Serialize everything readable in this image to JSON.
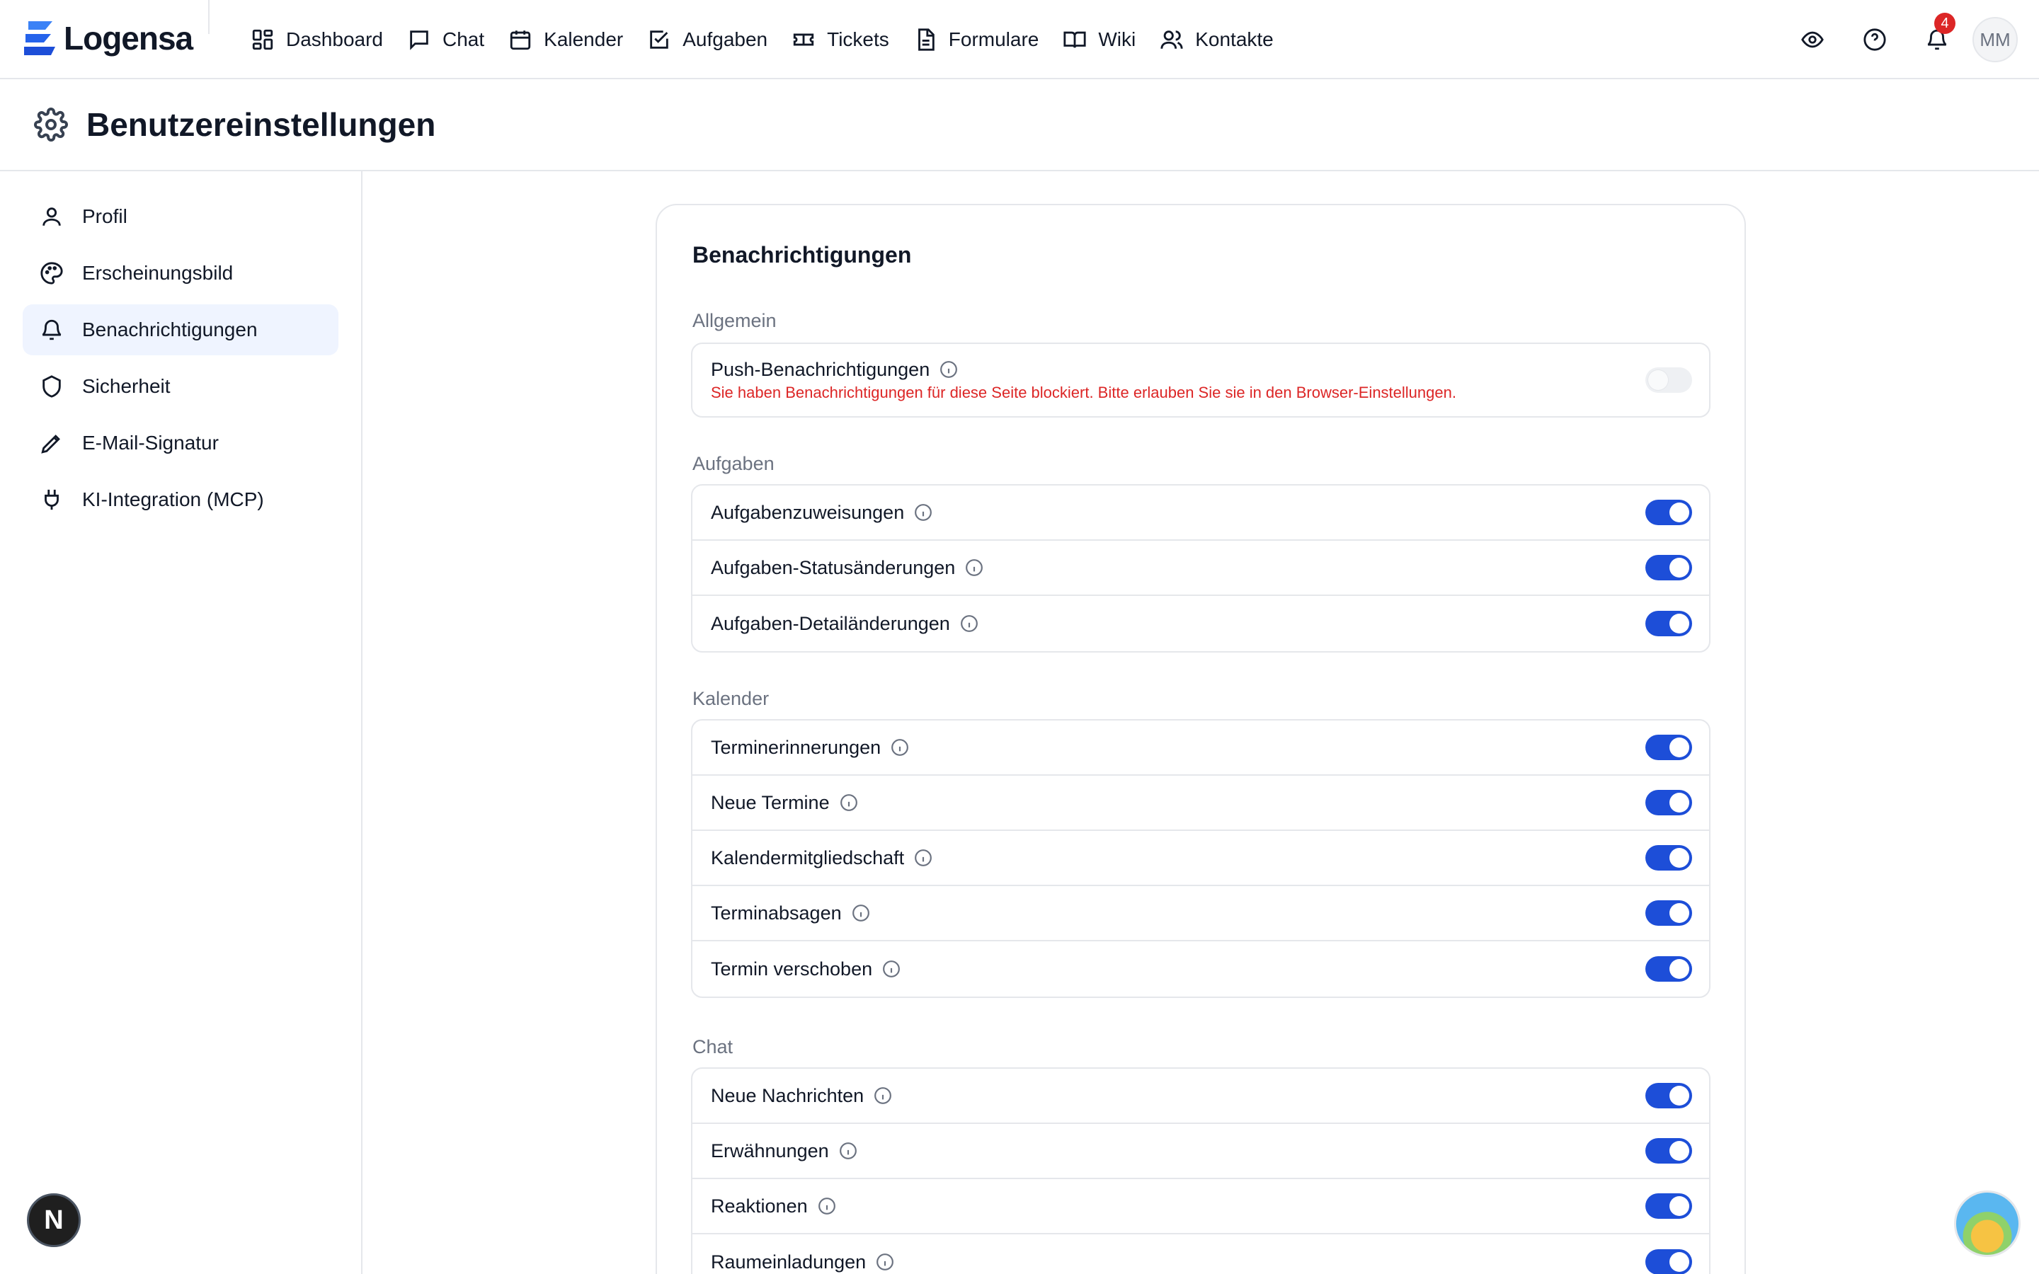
{
  "brand": {
    "name": "Logensa",
    "primary": "#1d4ed8",
    "accent": "#3b82f6"
  },
  "nav": [
    {
      "label": "Dashboard",
      "icon": "dashboard-icon"
    },
    {
      "label": "Chat",
      "icon": "chat-icon"
    },
    {
      "label": "Kalender",
      "icon": "calendar-icon"
    },
    {
      "label": "Aufgaben",
      "icon": "task-checkbox-icon"
    },
    {
      "label": "Tickets",
      "icon": "ticket-icon"
    },
    {
      "label": "Formulare",
      "icon": "form-document-icon"
    },
    {
      "label": "Wiki",
      "icon": "book-icon"
    },
    {
      "label": "Kontakte",
      "icon": "contacts-icon"
    }
  ],
  "topbar": {
    "notification_count": "4",
    "avatar_initials": "MM"
  },
  "page": {
    "title": "Benutzereinstellungen"
  },
  "sidebar": {
    "items": [
      {
        "label": "Profil",
        "icon": "user-icon"
      },
      {
        "label": "Erscheinungsbild",
        "icon": "palette-icon"
      },
      {
        "label": "Benachrichtigungen",
        "icon": "bell-icon",
        "active": true
      },
      {
        "label": "Sicherheit",
        "icon": "shield-icon"
      },
      {
        "label": "E-Mail-Signatur",
        "icon": "pen-icon"
      },
      {
        "label": "KI-Integration (MCP)",
        "icon": "plug-icon"
      }
    ]
  },
  "settings": {
    "title": "Benachrichtigungen",
    "general": {
      "label": "Allgemein",
      "push_label": "Push-Benachrichtigungen",
      "push_hint": "Sie haben Benachrichtigungen für diese Seite blockiert. Bitte erlauben Sie sie in den Browser-Einstellungen.",
      "push_enabled": false
    },
    "tasks": {
      "label": "Aufgaben",
      "items": [
        {
          "label": "Aufgabenzuweisungen",
          "enabled": true
        },
        {
          "label": "Aufgaben-Statusänderungen",
          "enabled": true
        },
        {
          "label": "Aufgaben-Detailänderungen",
          "enabled": true
        }
      ]
    },
    "calendar": {
      "label": "Kalender",
      "items": [
        {
          "label": "Terminerinnerungen",
          "enabled": true
        },
        {
          "label": "Neue Termine",
          "enabled": true
        },
        {
          "label": "Kalendermitgliedschaft",
          "enabled": true
        },
        {
          "label": "Terminabsagen",
          "enabled": true
        },
        {
          "label": "Termin verschoben",
          "enabled": true
        }
      ]
    },
    "chat": {
      "label": "Chat",
      "items": [
        {
          "label": "Neue Nachrichten",
          "enabled": true
        },
        {
          "label": "Erwähnungen",
          "enabled": true
        },
        {
          "label": "Reaktionen",
          "enabled": true
        },
        {
          "label": "Raumeinladungen",
          "enabled": true
        }
      ]
    }
  },
  "floating": {
    "devtools_letter": "N"
  }
}
